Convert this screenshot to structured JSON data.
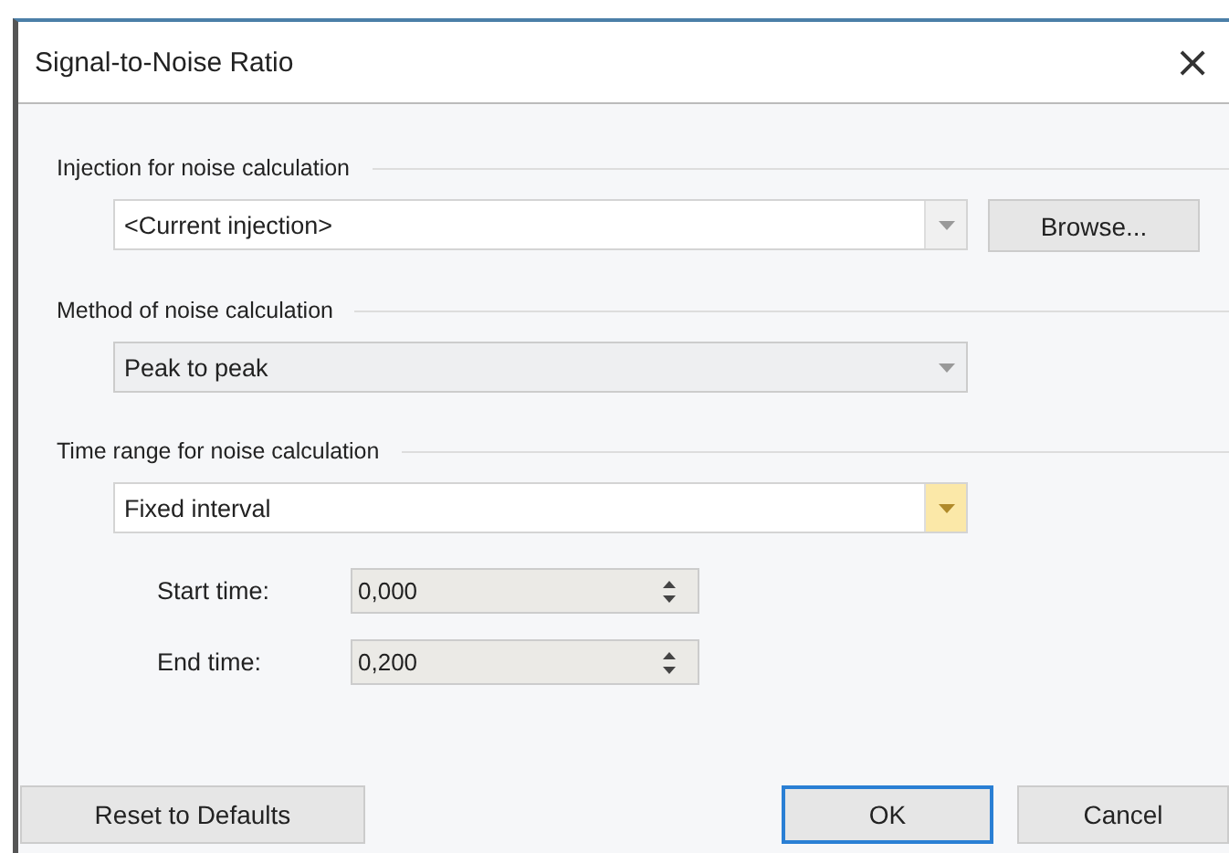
{
  "window": {
    "title": "Signal-to-Noise Ratio",
    "close": "×"
  },
  "sections": [
    {
      "label": "Injection for noise calculation",
      "combo": {
        "value": "<Current injection>",
        "kind": "editable",
        "hovered": false
      },
      "button": "Browse..."
    },
    {
      "label": "Method of noise calculation",
      "combo": {
        "value": "Peak to peak",
        "kind": "list",
        "hovered": false
      }
    },
    {
      "label": "Time range for noise calculation",
      "combo": {
        "value": "Fixed interval",
        "kind": "editable",
        "hovered": true
      },
      "spinners": [
        {
          "label": "Start time:",
          "value": "0,000"
        },
        {
          "label": "End time:",
          "value": "0,200"
        }
      ]
    }
  ],
  "buttons": [
    {
      "label": "Reset to Defaults",
      "default": false
    },
    {
      "label": "OK",
      "default": true
    },
    {
      "label": "Cancel",
      "default": false
    }
  ]
}
